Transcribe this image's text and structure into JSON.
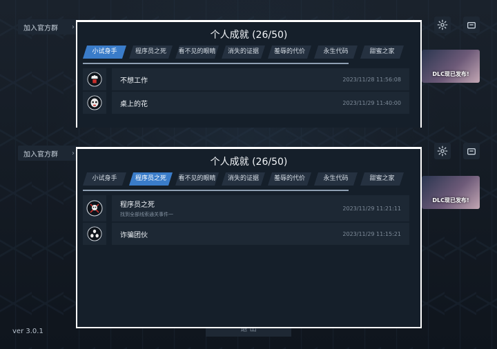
{
  "background": {
    "join_group_label": "加入官方群",
    "dlc_banner_text": "DLC现已发布!",
    "version": "ver 3.0.1",
    "exit_label": "退 出"
  },
  "colors": {
    "tab_active": "#3a7cc9",
    "panel_bg": "#151f2a",
    "panel_border": "#ffffff"
  },
  "panels": [
    {
      "title": "个人成就 (26/50)",
      "tabs": [
        "小试身手",
        "程序员之死",
        "看不见的眼睛",
        "消失的证据",
        "羞辱的代价",
        "永生代码",
        "甜蜜之家"
      ],
      "active_tab": 0,
      "progress": 0.52,
      "achievements": [
        {
          "icon": "chef-icon",
          "name": "不想工作",
          "desc": "",
          "time": "2023/11/28 11:56:08"
        },
        {
          "icon": "ghost-face-icon",
          "name": "桌上的花",
          "desc": "",
          "time": "2023/11/29 11:40:00"
        }
      ]
    },
    {
      "title": "个人成就 (26/50)",
      "tabs": [
        "小试身手",
        "程序员之死",
        "看不见的眼睛",
        "消失的证据",
        "羞辱的代价",
        "永生代码",
        "甜蜜之家"
      ],
      "active_tab": 1,
      "progress": 0.52,
      "achievements": [
        {
          "icon": "skull-swords-icon",
          "name": "程序员之死",
          "desc": "找到全部线索通关事件一",
          "time": "2023/11/29 11:21:11"
        },
        {
          "icon": "masks-icon",
          "name": "诈骗团伙",
          "desc": "",
          "time": "2023/11/29 11:15:21"
        }
      ]
    }
  ]
}
